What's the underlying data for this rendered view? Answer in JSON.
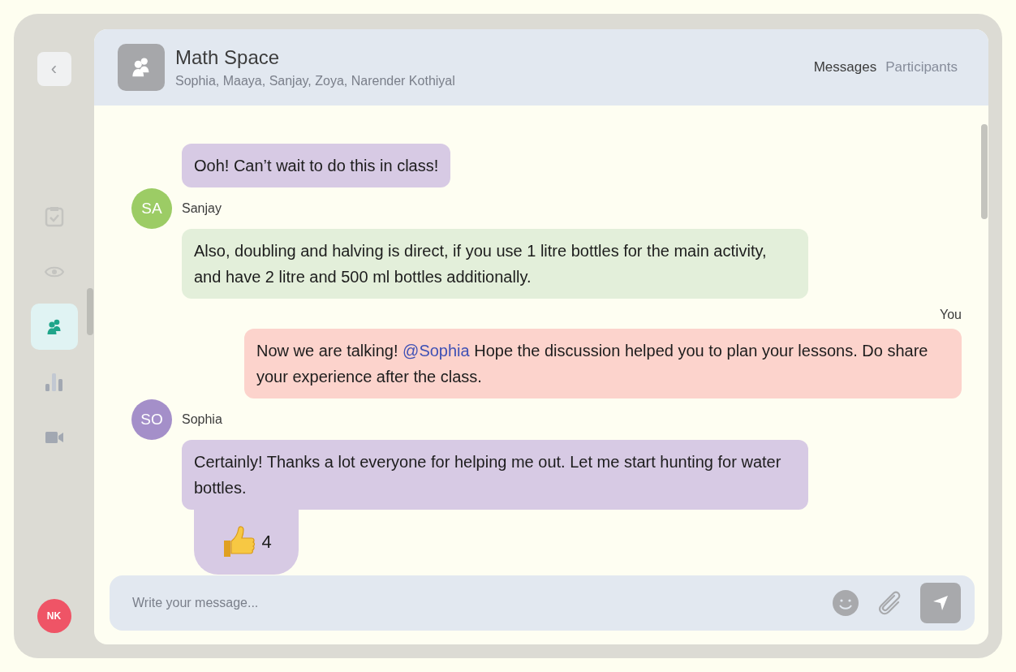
{
  "sidebar": {
    "back_button": {
      "label": "‹"
    },
    "items": [
      {
        "kind": "tasks",
        "selected": false
      },
      {
        "kind": "view",
        "selected": false
      },
      {
        "kind": "group",
        "selected": true
      },
      {
        "kind": "stats",
        "selected": false
      },
      {
        "kind": "video",
        "selected": false
      }
    ],
    "user_avatar": {
      "initials": "NK",
      "color": "#ef5466"
    }
  },
  "header": {
    "title": "Math Space",
    "members": "Sophia, Maaya, Sanjay, Zoya, Narender Kothiyal",
    "tabs": [
      {
        "label": "Messages",
        "selected": true
      },
      {
        "label": "Participants",
        "selected": false
      }
    ]
  },
  "messages": [
    {
      "kind": "received",
      "color": "#d7cae4",
      "parts": [
        {
          "kind": "plain",
          "text": "Ooh! Can’t wait to do this in class!"
        }
      ]
    },
    {
      "kind": "received",
      "sender": "Sanjay",
      "avatar": {
        "initials": "SA",
        "color": "#9ccc65"
      },
      "color": "#e3efda",
      "parts": [
        {
          "kind": "plain",
          "text": "Also, doubling and halving is direct, if you use 1 litre bottles for the main activity, and have 2 litre and 500 ml bottles additionally."
        }
      ]
    },
    {
      "kind": "sent",
      "sender": "You",
      "color": "#fcd3cc",
      "parts": [
        {
          "kind": "plain",
          "text": "Now we are talking! "
        },
        {
          "kind": "mention",
          "text": "@Sophia"
        },
        {
          "kind": "plain",
          "text": " Hope the discussion helped you to plan your lessons. Do share your experience after the class."
        }
      ]
    },
    {
      "kind": "received",
      "sender": "Sophia",
      "avatar": {
        "initials": "SO",
        "color": "#a48fc9"
      },
      "color": "#d7cae4",
      "parts": [
        {
          "kind": "plain",
          "text": "Certainly! Thanks a lot everyone for helping me out. Let me start hunting for water bottles."
        }
      ],
      "reaction": {
        "count": "4"
      }
    }
  ],
  "composer": {
    "placeholder": "Write your message..."
  }
}
